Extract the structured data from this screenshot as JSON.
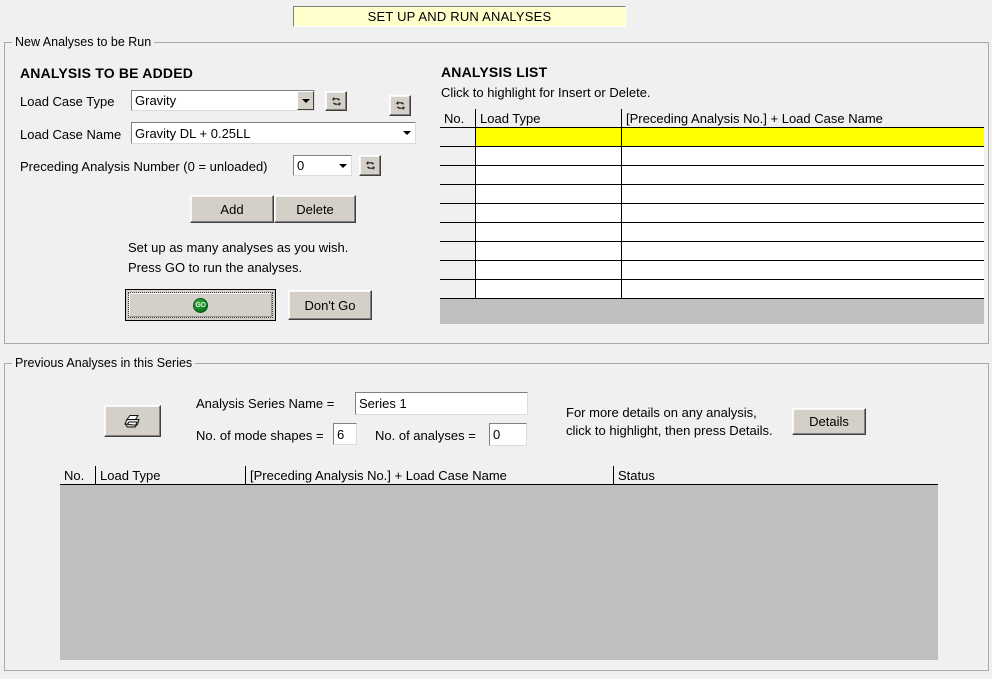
{
  "window": {
    "title_banner": "SET UP AND RUN ANALYSES"
  },
  "group_new": {
    "legend": "New Analyses to be Run",
    "heading": "ANALYSIS TO BE ADDED",
    "load_case_type": {
      "label": "Load Case Type",
      "value": "Gravity",
      "refresh_icon": "refresh-icon"
    },
    "load_case_name": {
      "label": "Load Case Name",
      "value": "Gravity DL + 0.25LL"
    },
    "preceding_analysis": {
      "label": "Preceding Analysis Number  (0 = unloaded)",
      "value": "0",
      "refresh_icon": "refresh-icon"
    },
    "extra_refresh_icon": "refresh-icon",
    "add_button": "Add",
    "delete_button": "Delete",
    "hint_line1": "Set up as many analyses as you wish.",
    "hint_line2": "Press GO to run the analyses.",
    "go_button": "GO",
    "dont_go_button": "Don't Go"
  },
  "analysis_list": {
    "heading": "ANALYSIS LIST",
    "subheading": "Click to highlight for Insert or Delete.",
    "columns": [
      "No.",
      "Load Type",
      "[Preceding Analysis No.] + Load Case Name"
    ],
    "selected_row_index": 0,
    "highlight_color": "#ffff00",
    "rows": [
      {
        "no": "",
        "load_type": "",
        "name": "",
        "selected": true
      },
      {
        "no": "",
        "load_type": "",
        "name": "",
        "selected": false
      },
      {
        "no": "",
        "load_type": "",
        "name": "",
        "selected": false
      },
      {
        "no": "",
        "load_type": "",
        "name": "",
        "selected": false
      },
      {
        "no": "",
        "load_type": "",
        "name": "",
        "selected": false
      },
      {
        "no": "",
        "load_type": "",
        "name": "",
        "selected": false
      },
      {
        "no": "",
        "load_type": "",
        "name": "",
        "selected": false
      },
      {
        "no": "",
        "load_type": "",
        "name": "",
        "selected": false
      },
      {
        "no": "",
        "load_type": "",
        "name": "",
        "selected": false
      }
    ]
  },
  "group_prev": {
    "legend": "Previous Analyses in this Series",
    "print_icon": "printer-icon",
    "series_name_label": "Analysis Series Name =",
    "series_name_value": "Series 1",
    "mode_shapes_label": "No. of mode shapes =",
    "mode_shapes_value": "6",
    "analyses_label": "No. of analyses =",
    "analyses_value": "0",
    "details_hint_line1": "For more details on any analysis,",
    "details_hint_line2": "click to highlight, then press Details.",
    "details_button": "Details",
    "columns": [
      "No.",
      "Load Type",
      "[Preceding Analysis No.] + Load Case Name",
      "Status"
    ],
    "rows": []
  }
}
